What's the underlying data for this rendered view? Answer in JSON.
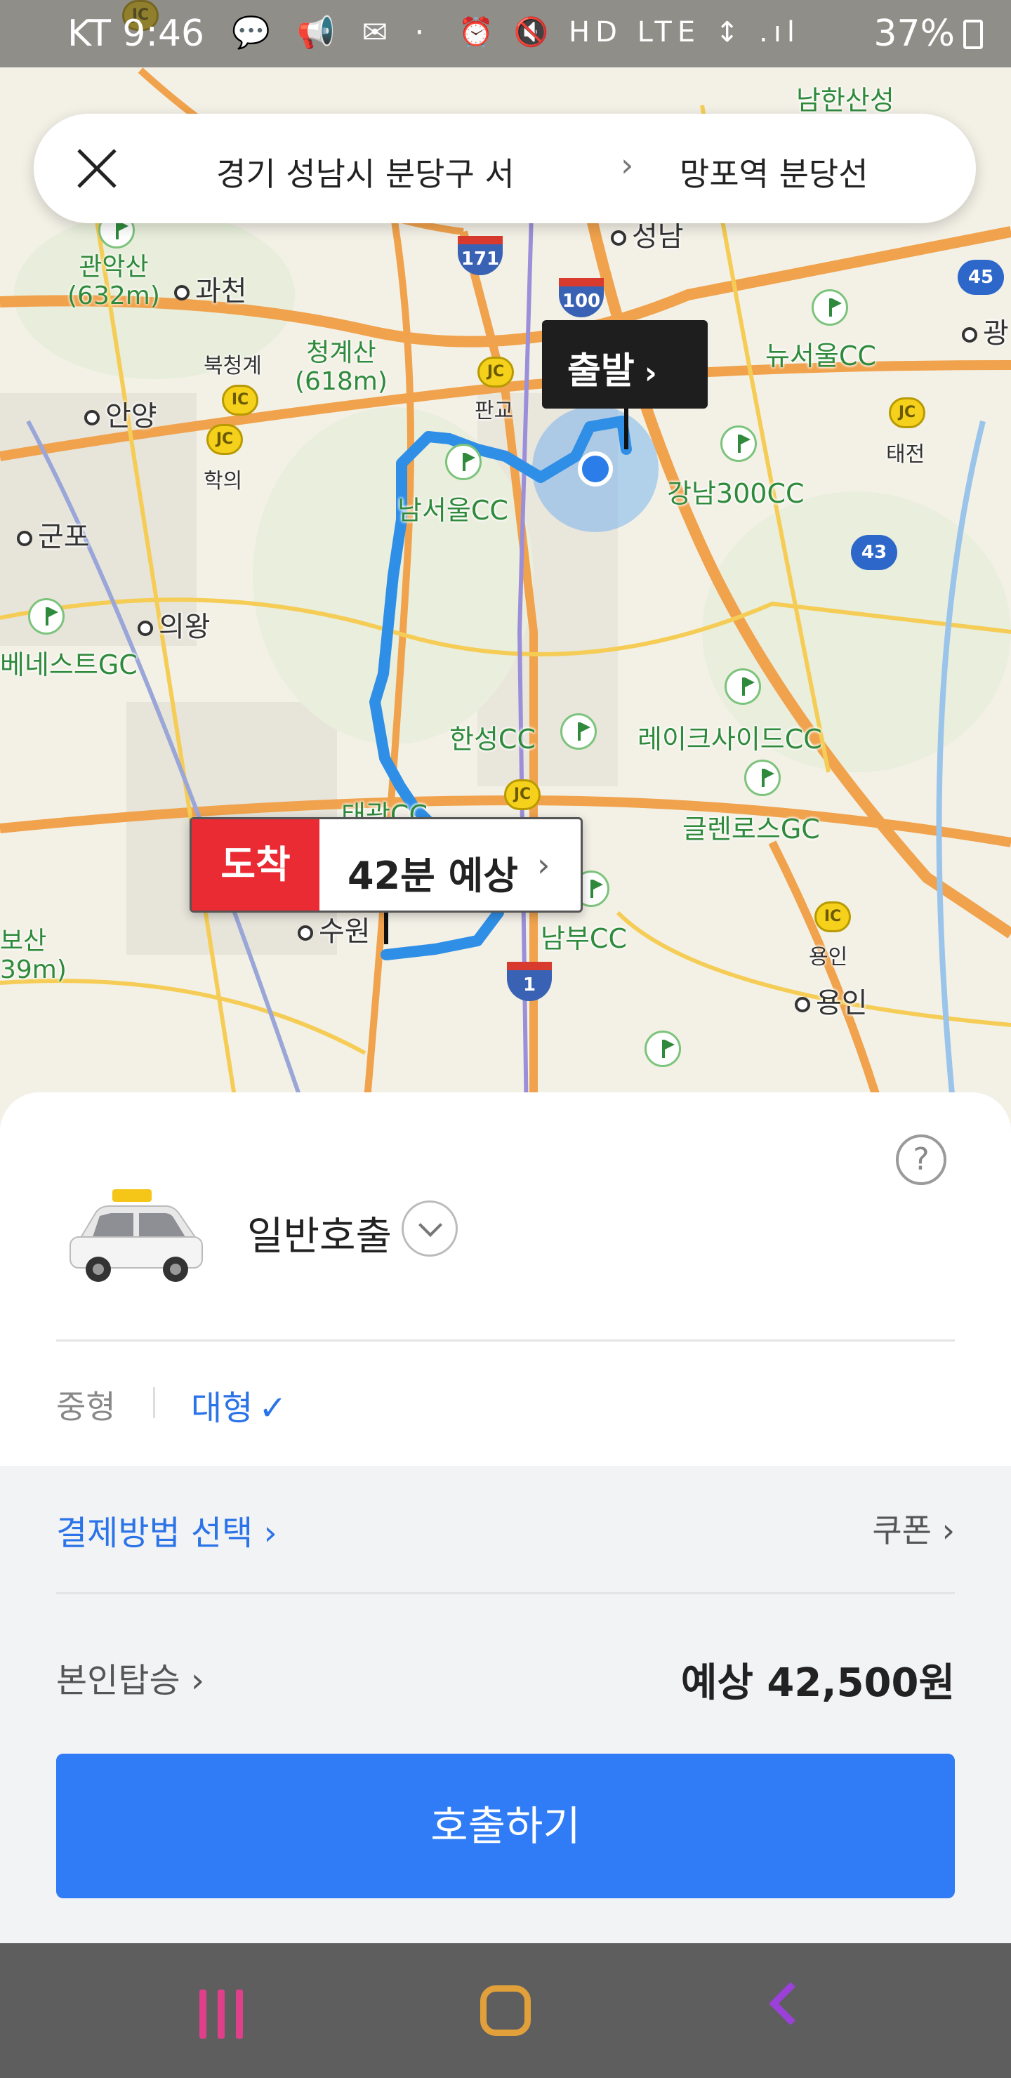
{
  "status_bar": {
    "carrier_time": "KT 9:46",
    "left_icons": "💬 📢 ✉ ·",
    "right_icons": "⏰ 🔇 HD LTE ↕ .ıl",
    "battery": "37%"
  },
  "route": {
    "origin": "경기 성남시 분당구 서",
    "chevron": "›",
    "destination": "망포역 분당선"
  },
  "map": {
    "start_label": "출발",
    "arrive_tag": "도착",
    "arrive_eta": "42분 예상",
    "callout_arrow": "›",
    "places": {
      "gwacheon": "과천",
      "anyang": "안양",
      "gunpo": "군포",
      "uiwang": "의왕",
      "suwon": "수원",
      "yongin": "용인",
      "seongnam": "성남",
      "gwangju": "광",
      "pangyo": "판교",
      "bukcheonggye": "북청계",
      "hagui": "학의",
      "taejeon": "태전",
      "yongin_jc": "용인",
      "namhansanseong": "남한산성"
    },
    "mountains": {
      "gwanaksan": "관악산\n(632m)",
      "cheonggyesan": "청계산\n(618m)",
      "bosan": "보산\n39m)"
    },
    "golf": {
      "new_seoul": "뉴서울CC",
      "gangnam300": "강남300CC",
      "nam_seoul": "남서울CC",
      "hanseong": "한성CC",
      "lakeside": "레이크사이드CC",
      "glenross": "글렌로스GC",
      "taegwang": "태광CC",
      "nambu": "남부CC",
      "benest": "베네스트GC"
    },
    "road_numbers": {
      "r171": "171",
      "r100": "100",
      "r45": "45",
      "r43": "43",
      "r1": "1"
    },
    "jc_label": "JC",
    "ic_label": "IC"
  },
  "sheet": {
    "help": "?",
    "call_type": "일반호출",
    "size_mid": "중형",
    "size_large": "대형",
    "size_check": "✓",
    "pay_method": "결제방법 선택 ›",
    "coupon": "쿠폰 ›",
    "self_ride": "본인탑승 ›",
    "estimated_fare": "예상 42,500원",
    "call_button": "호출하기"
  },
  "icons": {
    "close": "close-icon",
    "taxi": "taxi-icon",
    "help": "help-icon",
    "dropdown": "chevron-down-icon"
  },
  "colors": {
    "accent_blue": "#2f7cf6",
    "arrive_red": "#ea2b34",
    "route_blue": "#2f8fe6"
  }
}
